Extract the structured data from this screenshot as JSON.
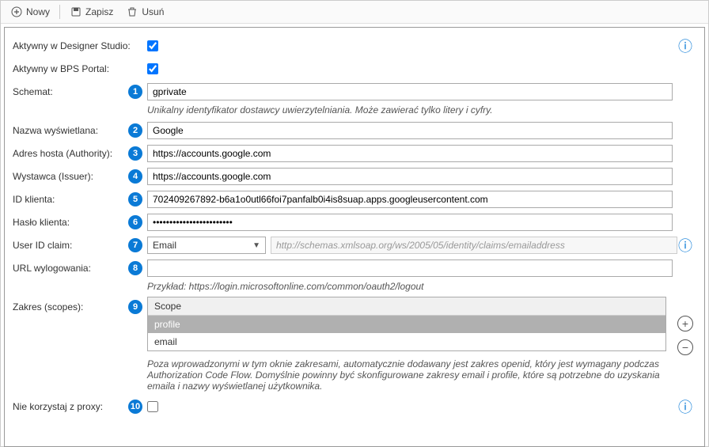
{
  "toolbar": {
    "new_label": "Nowy",
    "save_label": "Zapisz",
    "delete_label": "Usuń"
  },
  "fields": {
    "active_designer_label": "Aktywny w Designer Studio:",
    "active_designer_checked": true,
    "active_bps_label": "Aktywny w BPS Portal:",
    "active_bps_checked": true,
    "scheme_label": "Schemat:",
    "scheme_value": "gprivate",
    "scheme_hint": "Unikalny identyfikator dostawcy uwierzytelniania. Może zawierać tylko litery i cyfry.",
    "display_name_label": "Nazwa wyświetlana:",
    "display_name_value": "Google",
    "authority_label": "Adres hosta (Authority):",
    "authority_value": "https://accounts.google.com",
    "issuer_label": "Wystawca (Issuer):",
    "issuer_value": "https://accounts.google.com",
    "client_id_label": "ID klienta:",
    "client_id_value": "702409267892-b6a1o0utl66foi7panfalb0i4is8suap.apps.googleusercontent.com",
    "client_secret_label": "Hasło klienta:",
    "client_secret_value": "••••••••••••••••••••••••",
    "userid_claim_label": "User ID claim:",
    "userid_claim_value": "Email",
    "userid_claim_readonly": "http://schemas.xmlsoap.org/ws/2005/05/identity/claims/emailaddress",
    "logout_url_label": "URL wylogowania:",
    "logout_url_value": "",
    "logout_url_hint": "Przykład: https://login.microsoftonline.com/common/oauth2/logout",
    "scopes_label": "Zakres (scopes):",
    "scopes_header": "Scope",
    "scopes": [
      "profile",
      "email"
    ],
    "scopes_hint": "Poza wprowadzonymi w tym oknie zakresami, automatycznie dodawany jest zakres openid, który jest wymagany podczas Authorization Code Flow. Domyślnie powinny być skonfigurowane zakresy email i profile, które są potrzebne do uzyskania emaila i nazwy wyświetlanej użytkownika.",
    "proxy_label": "Nie korzystaj z proxy:",
    "proxy_checked": false
  },
  "badges": {
    "scheme": "1",
    "display_name": "2",
    "authority": "3",
    "issuer": "4",
    "client_id": "5",
    "client_secret": "6",
    "userid_claim": "7",
    "logout_url": "8",
    "scopes": "9",
    "proxy": "10"
  }
}
